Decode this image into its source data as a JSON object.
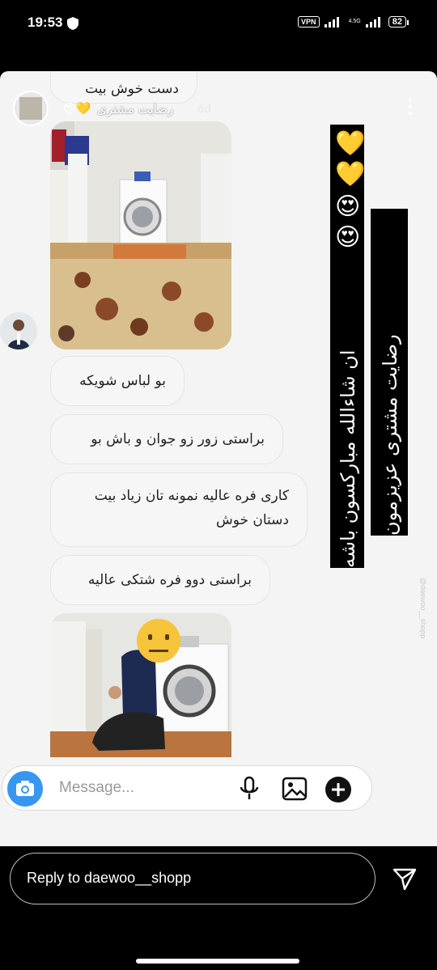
{
  "status_bar": {
    "time": "19:53",
    "vpn": "VPN",
    "network": "4.5G",
    "battery": "82"
  },
  "story": {
    "top_bubble": "دست خوش بيت",
    "header_name": "رضايت مشتری",
    "header_emoji": "😍💛",
    "age": "6d",
    "bubbles": [
      "بو لباس شويكه",
      "براستی زور زو جوان و باش بو",
      "كاری فره عاليه نمونه تان زياد بيت دستان خوش",
      "براستی دوو فره شتكی عاليه"
    ],
    "banner_line1": "ان شاءالله مبارکسون باشه",
    "banner_line2": "رضایت مشتری عزیزمون",
    "banner_emojis": [
      "😍",
      "😍",
      "💛",
      "💛"
    ],
    "watermark": "@daewoo__shopp",
    "composer_placeholder": "Message..."
  },
  "reply": {
    "placeholder": "Reply to daewoo__shopp"
  },
  "colors": {
    "accent": "#3797f0",
    "banner": "#000000",
    "bubble_bg": "#f6f6f6"
  }
}
